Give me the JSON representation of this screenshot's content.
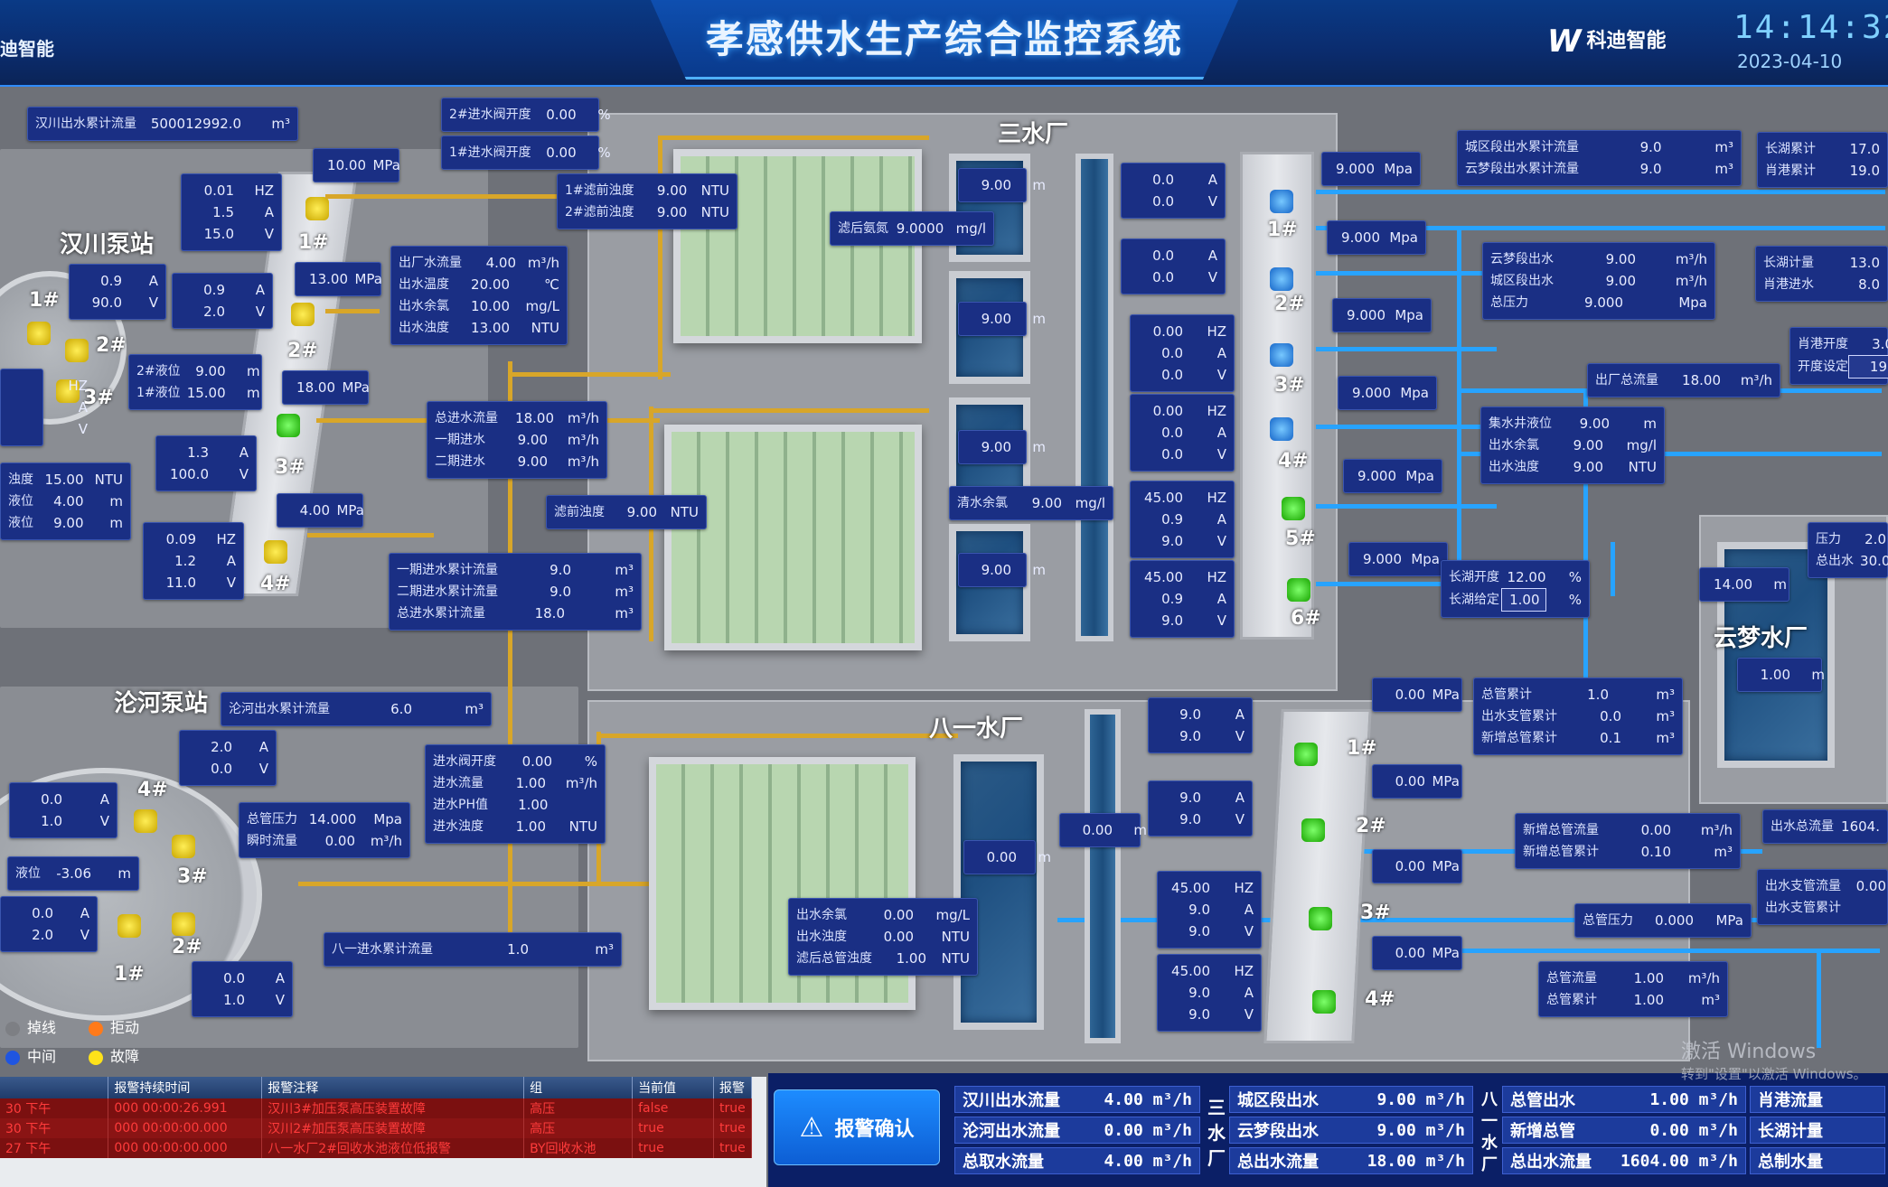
{
  "header": {
    "title": "孝感供水生产综合监控系统",
    "brand_left": "迪智能",
    "brand_right": "科迪智能",
    "clock": "14:14:32",
    "date": "2023-04-10"
  },
  "labels": {
    "hanchuan": "汉川泵站",
    "lunhe": "沦河泵站",
    "sanshui": "三水厂",
    "bayi": "八一水厂",
    "yunmeng": "云梦水厂"
  },
  "pump_tags": {
    "hc_tank_1": "1#",
    "hc_tank_2": "2#",
    "hc_tank_3": "3#",
    "hc_1": "1#",
    "hc_2": "2#",
    "hc_3": "3#",
    "hc_4": "4#",
    "ss_1": "1#",
    "ss_2": "2#",
    "ss_3": "3#",
    "ss_4": "4#",
    "ss_5": "5#",
    "ss_6": "6#",
    "by_1": "1#",
    "by_2": "2#",
    "by_3": "3#",
    "by_4": "4#",
    "lh_1": "1#",
    "lh_2": "2#",
    "lh_3": "3#",
    "lh_4": "4#"
  },
  "boxes": {
    "hc_total": {
      "k": "汉川出水累计流量",
      "v": "500012992.0",
      "u": "m³"
    },
    "v2_open": {
      "k": "2#进水阀开度",
      "v": "0.00",
      "u": "%"
    },
    "v1_open": {
      "k": "1#进水阀开度",
      "v": "0.00",
      "u": "%"
    },
    "mpa1": {
      "v": "10.00",
      "u": "MPa"
    },
    "mpa2": {
      "v": "13.00",
      "u": "MPa"
    },
    "mpa3": {
      "v": "18.00",
      "u": "MPa"
    },
    "mpa4": {
      "v": "4.00",
      "u": "MPa"
    },
    "hc_p1": [
      [
        "0.01",
        "HZ"
      ],
      [
        "1.5",
        "A"
      ],
      [
        "15.0",
        "V"
      ]
    ],
    "hc_p2": [
      [
        "0.9",
        "A"
      ],
      [
        "2.0",
        "V"
      ]
    ],
    "hc_p3": [
      [
        "1.3",
        "A"
      ],
      [
        "100.0",
        "V"
      ]
    ],
    "hc_p4": [
      [
        "0.09",
        "HZ"
      ],
      [
        "1.2",
        "A"
      ],
      [
        "11.0",
        "V"
      ]
    ],
    "hc_left1": [
      [
        "0.9",
        "A"
      ],
      [
        "90.0",
        "V"
      ]
    ],
    "hc_left2": [
      [
        "HZ"
      ],
      [
        "A"
      ],
      [
        "V"
      ]
    ],
    "hc_level": [
      {
        "k": "2#液位",
        "v": "9.00",
        "u": "m"
      },
      {
        "k": "1#液位",
        "v": "15.00",
        "u": "m"
      }
    ],
    "hc_turb": [
      {
        "k": "浊度",
        "v": "15.00",
        "u": "NTU"
      },
      {
        "k": "液位",
        "v": "4.00",
        "u": "m"
      },
      {
        "k": "液位",
        "v": "9.00",
        "u": "m"
      }
    ],
    "out_plant": [
      {
        "k": "出厂水流量",
        "v": "4.00",
        "u": "m³/h"
      },
      {
        "k": "出水温度",
        "v": "20.00",
        "u": "℃"
      },
      {
        "k": "出水余氯",
        "v": "10.00",
        "u": "mg/L"
      },
      {
        "k": "出水浊度",
        "v": "13.00",
        "u": "NTU"
      }
    ],
    "pre_turb": [
      {
        "k": "1#滤前浊度",
        "v": "9.00",
        "u": "NTU"
      },
      {
        "k": "2#滤前浊度",
        "v": "9.00",
        "u": "NTU"
      }
    ],
    "post_cl": {
      "k": "滤后氨氮",
      "v": "9.0000",
      "u": "mg/l"
    },
    "inflow": [
      {
        "k": "总进水流量",
        "v": "18.00",
        "u": "m³/h"
      },
      {
        "k": "一期进水",
        "v": "9.00",
        "u": "m³/h"
      },
      {
        "k": "二期进水",
        "v": "9.00",
        "u": "m³/h"
      }
    ],
    "pre_turb2": {
      "k": "滤前浊度",
      "v": "9.00",
      "u": "NTU"
    },
    "cumul": [
      {
        "k": "一期进水累计流量",
        "v": "9.0",
        "u": "m³"
      },
      {
        "k": "二期进水累计流量",
        "v": "9.0",
        "u": "m³"
      },
      {
        "k": "总进水累计流量",
        "v": "18.0",
        "u": "m³"
      }
    ],
    "ss_pool": [
      {
        "v": "9.00",
        "u": "m"
      },
      {
        "v": "9.00",
        "u": "m"
      },
      {
        "v": "9.00",
        "u": "m"
      },
      {
        "v": "9.00",
        "u": "m"
      }
    ],
    "clear_cl": {
      "k": "清水余氯",
      "v": "9.00",
      "u": "mg/l"
    },
    "ss_pump": [
      [
        [
          "0.0",
          "A"
        ],
        [
          "0.0",
          "V"
        ]
      ],
      [
        [
          "0.0",
          "A"
        ],
        [
          "0.0",
          "V"
        ]
      ],
      [
        [
          "0.00",
          "HZ"
        ],
        [
          "0.0",
          "A"
        ],
        [
          "0.0",
          "V"
        ]
      ],
      [
        [
          "0.00",
          "HZ"
        ],
        [
          "0.0",
          "A"
        ],
        [
          "0.0",
          "V"
        ]
      ],
      [
        [
          "45.00",
          "HZ"
        ],
        [
          "0.9",
          "A"
        ],
        [
          "9.0",
          "V"
        ]
      ],
      [
        [
          "45.00",
          "HZ"
        ],
        [
          "0.9",
          "A"
        ],
        [
          "9.0",
          "V"
        ]
      ]
    ],
    "ss_mpa": [
      "9.000",
      "9.000",
      "9.000",
      "9.000",
      "9.000",
      "9.000"
    ],
    "ss_mpa_unit": "Mpa",
    "city_total": [
      {
        "k": "城区段出水累计流量",
        "v": "9.0",
        "u": "m³"
      },
      {
        "k": "云梦段出水累计流量",
        "v": "9.0",
        "u": "m³"
      }
    ],
    "right_total": [
      {
        "k": "长湖累计",
        "v": "17.0"
      },
      {
        "k": "肖港累计",
        "v": "19.0"
      }
    ],
    "yunmeng_out": [
      {
        "k": "云梦段出水",
        "v": "9.00",
        "u": "m³/h"
      },
      {
        "k": "城区段出水",
        "v": "9.00",
        "u": "m³/h"
      },
      {
        "k": "总压力",
        "v": "9.000",
        "u": "Mpa"
      }
    ],
    "right2": [
      {
        "k": "长湖计量",
        "v": "13.0"
      },
      {
        "k": "肖港进水",
        "v": "8.0"
      }
    ],
    "right3": [
      {
        "k": "肖港开度",
        "v": "3.0"
      },
      {
        "k": "开度设定",
        "v": "19"
      }
    ],
    "out_total": {
      "k": "出厂总流量",
      "v": "18.00",
      "u": "m³/h"
    },
    "well": [
      {
        "k": "集水井液位",
        "v": "9.00",
        "u": "m"
      },
      {
        "k": "出水余氯",
        "v": "9.00",
        "u": "mg/l"
      },
      {
        "k": "出水浊度",
        "v": "9.00",
        "u": "NTU"
      }
    ],
    "changhu": [
      {
        "k": "长湖开度",
        "v": "12.00",
        "u": "%"
      },
      {
        "k": "长湖给定",
        "v": "1.00",
        "u": "%"
      }
    ],
    "yunmeng_lvl": {
      "v": "14.00",
      "u": "m"
    },
    "yunmeng_lvl2": {
      "v": "1.00",
      "u": "m"
    },
    "right_press": [
      {
        "k": "压力",
        "v": "2.0"
      },
      {
        "k": "总出水",
        "v": "30.00"
      }
    ],
    "lh_total": {
      "k": "沦河出水累计流量",
      "v": "6.0",
      "u": "m³"
    },
    "lh_p1": [
      [
        "2.0",
        "A"
      ],
      [
        "0.0",
        "V"
      ]
    ],
    "lh_p2": [
      [
        "0.0",
        "A"
      ],
      [
        "1.0",
        "V"
      ]
    ],
    "lh_p3": [
      [
        "0.0",
        "A"
      ],
      [
        "2.0",
        "V"
      ]
    ],
    "lh_p4": [
      [
        "0.0",
        "A"
      ],
      [
        "1.0",
        "V"
      ]
    ],
    "lh_level": {
      "k": "液位",
      "v": "-3.06",
      "u": "m"
    },
    "lh_press": [
      {
        "k": "总管压力",
        "v": "14.000",
        "u": "Mpa"
      },
      {
        "k": "瞬时流量",
        "v": "0.00",
        "u": "m³/h"
      }
    ],
    "by_in": [
      {
        "k": "进水阀开度",
        "v": "0.00",
        "u": "%"
      },
      {
        "k": "进水流量",
        "v": "1.00",
        "u": "m³/h"
      },
      {
        "k": "进水PH值",
        "v": "1.00",
        "u": ""
      },
      {
        "k": "进水浊度",
        "v": "1.00",
        "u": "NTU"
      }
    ],
    "by_cumul": {
      "k": "八一进水累计流量",
      "v": "1.0",
      "u": "m³"
    },
    "by_out": [
      {
        "k": "出水余氯",
        "v": "0.00",
        "u": "mg/L"
      },
      {
        "k": "出水浊度",
        "v": "0.00",
        "u": "NTU"
      },
      {
        "k": "滤后总管浊度",
        "v": "1.00",
        "u": "NTU"
      }
    ],
    "by_pool": [
      {
        "v": "0.00",
        "u": "m"
      },
      {
        "v": "0.00",
        "u": "m"
      }
    ],
    "by_pump": [
      [
        [
          "9.0",
          "A"
        ],
        [
          "9.0",
          "V"
        ]
      ],
      [
        [
          "9.0",
          "A"
        ],
        [
          "9.0",
          "V"
        ]
      ],
      [
        [
          "45.00",
          "HZ"
        ],
        [
          "9.0",
          "A"
        ],
        [
          "9.0",
          "V"
        ]
      ],
      [
        [
          "45.00",
          "HZ"
        ],
        [
          "9.0",
          "A"
        ],
        [
          "9.0",
          "V"
        ]
      ]
    ],
    "by_mpa": [
      "0.00",
      "0.00",
      "0.00",
      "0.00"
    ],
    "by_mpa_unit": "MPa",
    "by_sum": [
      {
        "k": "总管累计",
        "v": "1.0",
        "u": "m³"
      },
      {
        "k": "出水支管累计",
        "v": "0.0",
        "u": "m³"
      },
      {
        "k": "新增总管累计",
        "v": "0.1",
        "u": "m³"
      }
    ],
    "new_main": [
      {
        "k": "新增总管流量",
        "v": "0.00",
        "u": "m³/h"
      },
      {
        "k": "新增总管累计",
        "v": "0.10",
        "u": "m³"
      }
    ],
    "out_sum_r": {
      "k": "出水总流量",
      "v": "1604."
    },
    "branch": [
      {
        "k": "出水支管流量",
        "v": "0.00"
      },
      {
        "k": "出水支管累计",
        "v": ""
      }
    ],
    "main_press": {
      "k": "总管压力",
      "v": "0.000",
      "u": "MPa"
    },
    "main_flow": [
      {
        "k": "总管流量",
        "v": "1.00",
        "u": "m³/h"
      },
      {
        "k": "总管累计",
        "v": "1.00",
        "u": "m³"
      }
    ]
  },
  "legend": [
    {
      "label": "掉线",
      "color": "#7d7f84"
    },
    {
      "label": "拒动",
      "color": "#ff7a1a"
    },
    {
      "label": "中间",
      "color": "#1f55e0"
    },
    {
      "label": "故障",
      "color": "#ffe21a"
    }
  ],
  "alarm": {
    "headers": [
      "",
      "报警持续时间",
      "报警注释",
      "组",
      "当前值",
      "报警"
    ],
    "rows": [
      [
        "30 下午",
        "000 00:00:26.991",
        "汉川3#加压泵高压装置故障",
        "高压",
        "false",
        "true"
      ],
      [
        "30 下午",
        "000 00:00:00.000",
        "汉川2#加压泵高压装置故障",
        "高压",
        "true",
        "true"
      ],
      [
        "27 下午",
        "000 00:00:00.000",
        "八一水厂2#回收水池液位低报警",
        "BY回收水池",
        "true",
        "true"
      ]
    ]
  },
  "ack": {
    "label": "报警确认"
  },
  "stats": {
    "c1": [
      {
        "k": "汉川出水流量",
        "v": "4.00",
        "u": "m³/h"
      },
      {
        "k": "沦河出水流量",
        "v": "0.00",
        "u": "m³/h"
      },
      {
        "k": "总取水流量",
        "v": "4.00",
        "u": "m³/h"
      }
    ],
    "c2_side": "三水厂",
    "c2": [
      {
        "k": "城区段出水",
        "v": "9.00",
        "u": "m³/h"
      },
      {
        "k": "云梦段出水",
        "v": "9.00",
        "u": "m³/h"
      },
      {
        "k": "总出水流量",
        "v": "18.00",
        "u": "m³/h"
      }
    ],
    "c3_side": "八一水厂",
    "c3": [
      {
        "k": "总管出水",
        "v": "1.00",
        "u": "m³/h"
      },
      {
        "k": "新增总管",
        "v": "0.00",
        "u": "m³/h"
      },
      {
        "k": "总出水流量",
        "v": "1604.00",
        "u": "m³/h"
      }
    ],
    "c4": [
      {
        "k": "肖港流量"
      },
      {
        "k": "长湖计量"
      },
      {
        "k": "总制水量"
      }
    ]
  },
  "watermark": {
    "l1": "激活 Windows",
    "l2": "转到\"设置\"以激活 Windows。"
  }
}
